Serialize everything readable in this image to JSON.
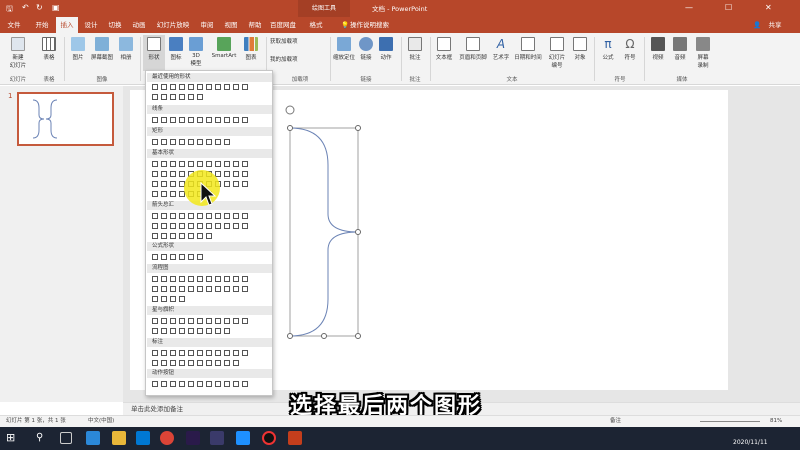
{
  "titlebar": {
    "contextual_tab": "绘图工具",
    "title": "文档 - PowerPoint",
    "save_icon": "save-icon",
    "undo_icon": "undo-icon",
    "redo_icon": "redo-icon"
  },
  "tabs": [
    "文件",
    "开始",
    "插入",
    "设计",
    "切换",
    "动画",
    "幻灯片放映",
    "审阅",
    "视图",
    "帮助",
    "百度网盘",
    "格式"
  ],
  "active_tab": "插入",
  "tell_me": "操作说明搜索",
  "share": "共享",
  "ribbon": {
    "new_slide": "新建\n幻灯片",
    "table": "表格",
    "picture": "图片",
    "screenshot": "屏幕截图",
    "album": "相册",
    "shapes": "形状",
    "icons": "图标",
    "model3d": "3D\n模型",
    "smartart": "SmartArt",
    "chart": "图表",
    "get_addins": "获取加载项",
    "my_addins": "我的加载项",
    "zoom": "缩放定位",
    "link": "链接",
    "action": "动作",
    "comment": "批注",
    "textbox": "文本框",
    "header_footer": "页眉和页脚",
    "wordart": "艺术字",
    "datetime": "日期和时间",
    "slide_number": "幻灯片\n编号",
    "object": "对象",
    "equation": "公式",
    "symbol": "符号",
    "video": "视频",
    "audio": "音频",
    "screen_record": "屏幕\n录制",
    "groups": {
      "slides": "幻灯片",
      "tables": "表格",
      "images": "图像",
      "addins": "加载项",
      "links": "链接",
      "comments": "批注",
      "text": "文本",
      "symbols": "符号",
      "media": "媒体"
    }
  },
  "dropdown": {
    "sections": [
      "最近使用的形状",
      "线条",
      "矩形",
      "基本形状",
      "箭头总汇",
      "公式形状",
      "流程图",
      "星与旗帜",
      "标注",
      "动作按钮"
    ]
  },
  "slide_panel": {
    "number": "1"
  },
  "notes_placeholder": "单击此处添加备注",
  "status": {
    "slide_info": "幻灯片 第 1 张，共 1 张",
    "language": "中文(中国)",
    "notes_btn": "备注",
    "zoom": "81%"
  },
  "caption": "选择最后两个图形",
  "taskbar": {
    "date": "2020/11/11"
  },
  "colors": {
    "accent": "#b7472a",
    "shape_stroke": "#6b83b5",
    "highlight": "#f2e81a"
  }
}
